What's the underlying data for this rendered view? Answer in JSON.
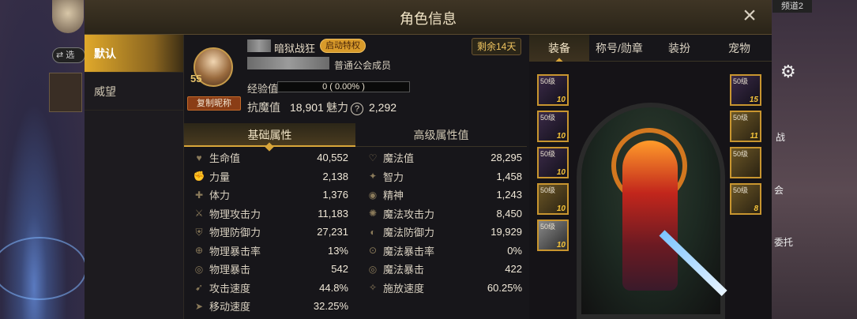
{
  "bg": {
    "channel": "频道2",
    "side_chip": "⇄ 选",
    "tags": [
      "战",
      "会",
      "委托"
    ]
  },
  "modal": {
    "title": "角色信息",
    "nav": [
      {
        "label": "默认",
        "active": true
      },
      {
        "label": "威望",
        "active": false
      }
    ],
    "profile": {
      "level": "55",
      "job": "暗狱战狂",
      "privilege": "启动特权",
      "guild": "普通公会成员",
      "copy_btn": "复制昵称",
      "exp_label": "经验值",
      "exp_value": "0 ( 0.00% )",
      "resist_label": "抗魔值",
      "resist_value": "18,901",
      "charm_label": "魅力",
      "charm_value": "2,292",
      "remain": "剩余14天"
    },
    "subtabs": [
      {
        "label": "基础属性",
        "active": true
      },
      {
        "label": "高级属性值",
        "active": false
      }
    ],
    "stats_left": [
      {
        "label": "生命值",
        "value": "40,552"
      },
      {
        "label": "力量",
        "value": "2,138"
      },
      {
        "label": "体力",
        "value": "1,376"
      },
      {
        "label": "物理攻击力",
        "value": "11,183"
      },
      {
        "label": "物理防御力",
        "value": "27,231"
      },
      {
        "label": "物理暴击率",
        "value": "13%"
      },
      {
        "label": "物理暴击",
        "value": "542"
      },
      {
        "label": "攻击速度",
        "value": "44.8%"
      },
      {
        "label": "移动速度",
        "value": "32.25%"
      }
    ],
    "stats_right": [
      {
        "label": "魔法值",
        "value": "28,295"
      },
      {
        "label": "智力",
        "value": "1,458"
      },
      {
        "label": "精神",
        "value": "1,243"
      },
      {
        "label": "魔法攻击力",
        "value": "8,450"
      },
      {
        "label": "魔法防御力",
        "value": "19,929"
      },
      {
        "label": "魔法暴击率",
        "value": "0%"
      },
      {
        "label": "魔法暴击",
        "value": "422"
      },
      {
        "label": "施放速度",
        "value": "60.25%"
      }
    ],
    "eq_tabs": [
      {
        "label": "装备",
        "active": true
      },
      {
        "label": "称号/勋章",
        "active": false
      },
      {
        "label": "装扮",
        "active": false
      },
      {
        "label": "宠物",
        "active": false
      }
    ],
    "left_slots": [
      {
        "lv": "50级",
        "en": "10"
      },
      {
        "lv": "50级",
        "en": "10"
      },
      {
        "lv": "50级",
        "en": "10"
      },
      {
        "lv": "50级",
        "en": "10"
      },
      {
        "lv": "50级",
        "en": "10"
      }
    ],
    "right_slots": [
      {
        "lv": "50级",
        "en": "15"
      },
      {
        "lv": "50级",
        "en": "11"
      },
      {
        "lv": "50级",
        "en": ""
      },
      {
        "lv": "50级",
        "en": "8"
      }
    ]
  }
}
